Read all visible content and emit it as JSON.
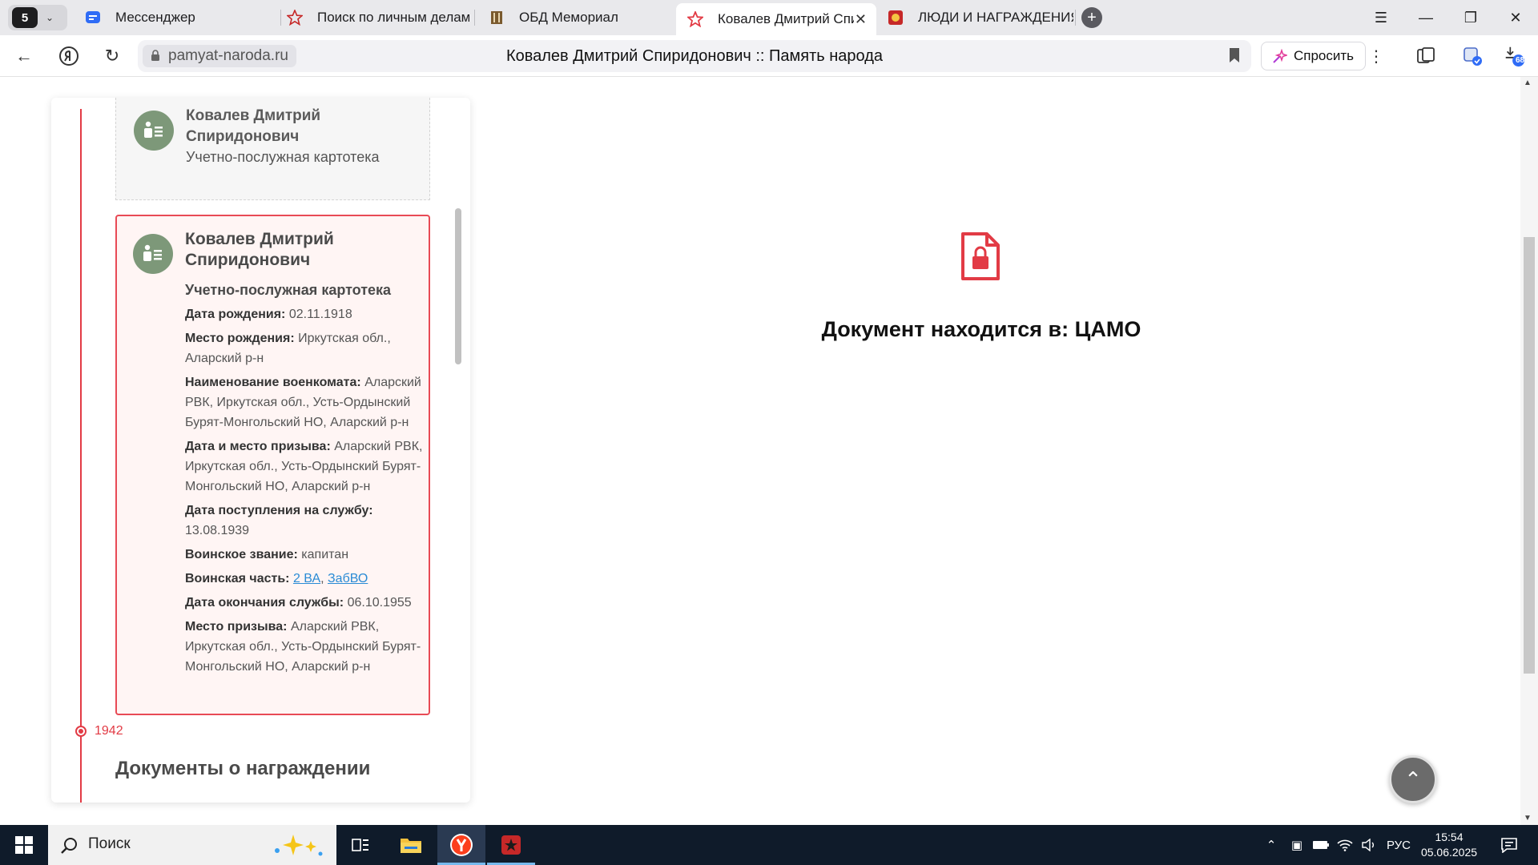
{
  "browser": {
    "tab_count": "5",
    "tabs": [
      {
        "label": "Мессенджер",
        "icon": "messenger-icon"
      },
      {
        "label": "Поиск по личным делам I",
        "icon": "red-star-icon"
      },
      {
        "label": "ОБД Мемориал",
        "icon": "memorial-icon"
      },
      {
        "label": "Ковалев Дмитрий Спи",
        "icon": "red-star-outline-icon",
        "active": true
      },
      {
        "label": "ЛЮДИ И НАГРАЖДЕНИЯ",
        "icon": "award-icon"
      }
    ],
    "address": {
      "domain": "pamyat-naroda.ru",
      "page_title": "Ковалев Дмитрий Спиридонович :: Память народа"
    },
    "ask_label": "Спросить",
    "downloads_badge": "68",
    "accent_color": "#e23b45"
  },
  "page": {
    "card1": {
      "name_line1": "Ковалев Дмитрий",
      "name_line2": "Спиридонович",
      "doc_kind": "Учетно-послужная картотека"
    },
    "card2": {
      "name_line1": "Ковалев Дмитрий",
      "name_line2": "Спиридонович",
      "doc_kind": "Учетно-послужная картотека",
      "fields": {
        "birth_date_label": "Дата рождения:",
        "birth_date": "02.11.1918",
        "birth_place_label": "Место рождения:",
        "birth_place": "Иркутская обл., Аларский р-н",
        "commissariat_label": "Наименование военкомата:",
        "commissariat": "Аларский РВК, Иркутская обл., Усть-Ордынский Бурят-Монгольский НО, Аларский р-н",
        "draft_label": "Дата и место призыва:",
        "draft": "Аларский РВК, Иркутская обл., Усть-Ордынский Бурят-Монгольский НО, Аларский р-н",
        "service_start_label": "Дата поступления на службу:",
        "service_start": "13.08.1939",
        "rank_label": "Воинское звание:",
        "rank": "капитан",
        "unit_label": "Воинская часть:",
        "unit_link1": "2 ВА",
        "unit_sep": ",",
        "unit_link2": "ЗабВО",
        "service_end_label": "Дата окончания службы:",
        "service_end": "06.10.1955",
        "draft_place_label": "Место призыва:",
        "draft_place": "Аларский РВК, Иркутская обл., Усть-Ордынский Бурят-Монгольский НО, Аларский р-н"
      }
    },
    "timeline_year": "1942",
    "section_title": "Документы о награждении",
    "document_location": "Документ находится в: ЦАМО"
  },
  "taskbar": {
    "search_placeholder": "Поиск",
    "language": "РУС",
    "time": "15:54",
    "date": "05.06.2025"
  }
}
